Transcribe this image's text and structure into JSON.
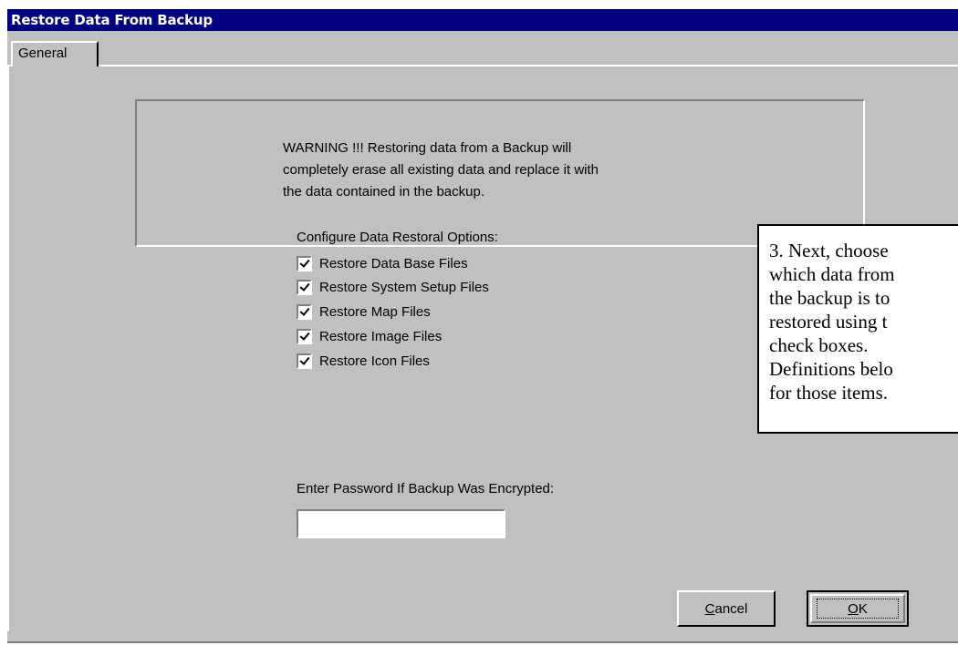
{
  "window": {
    "title": "Restore Data From Backup"
  },
  "tabs": [
    {
      "label": "General",
      "selected": true
    }
  ],
  "warning": {
    "lines": [
      "WARNING !!! Restoring data from a Backup will",
      "completely erase all existing data and replace it with",
      "the data contained in the backup."
    ]
  },
  "options": {
    "heading": "Configure Data Restoral Options:",
    "items": [
      {
        "label": "Restore Data Base Files",
        "checked": true
      },
      {
        "label": "Restore System Setup Files",
        "checked": true
      },
      {
        "label": "Restore Map Files",
        "checked": true
      },
      {
        "label": "Restore Image Files",
        "checked": true
      },
      {
        "label": "Restore Icon Files",
        "checked": true
      }
    ]
  },
  "password": {
    "label": "Enter Password If Backup Was Encrypted:",
    "value": ""
  },
  "callout": {
    "lines": [
      "3. Next, choose",
      "which data from",
      "the backup is to",
      "restored using t",
      "check boxes.",
      "Definitions belo",
      "for those items."
    ]
  },
  "buttons": {
    "cancel_mnemonic": "C",
    "cancel_rest": "ancel",
    "ok_mnemonic": "O",
    "ok_rest": "K"
  }
}
